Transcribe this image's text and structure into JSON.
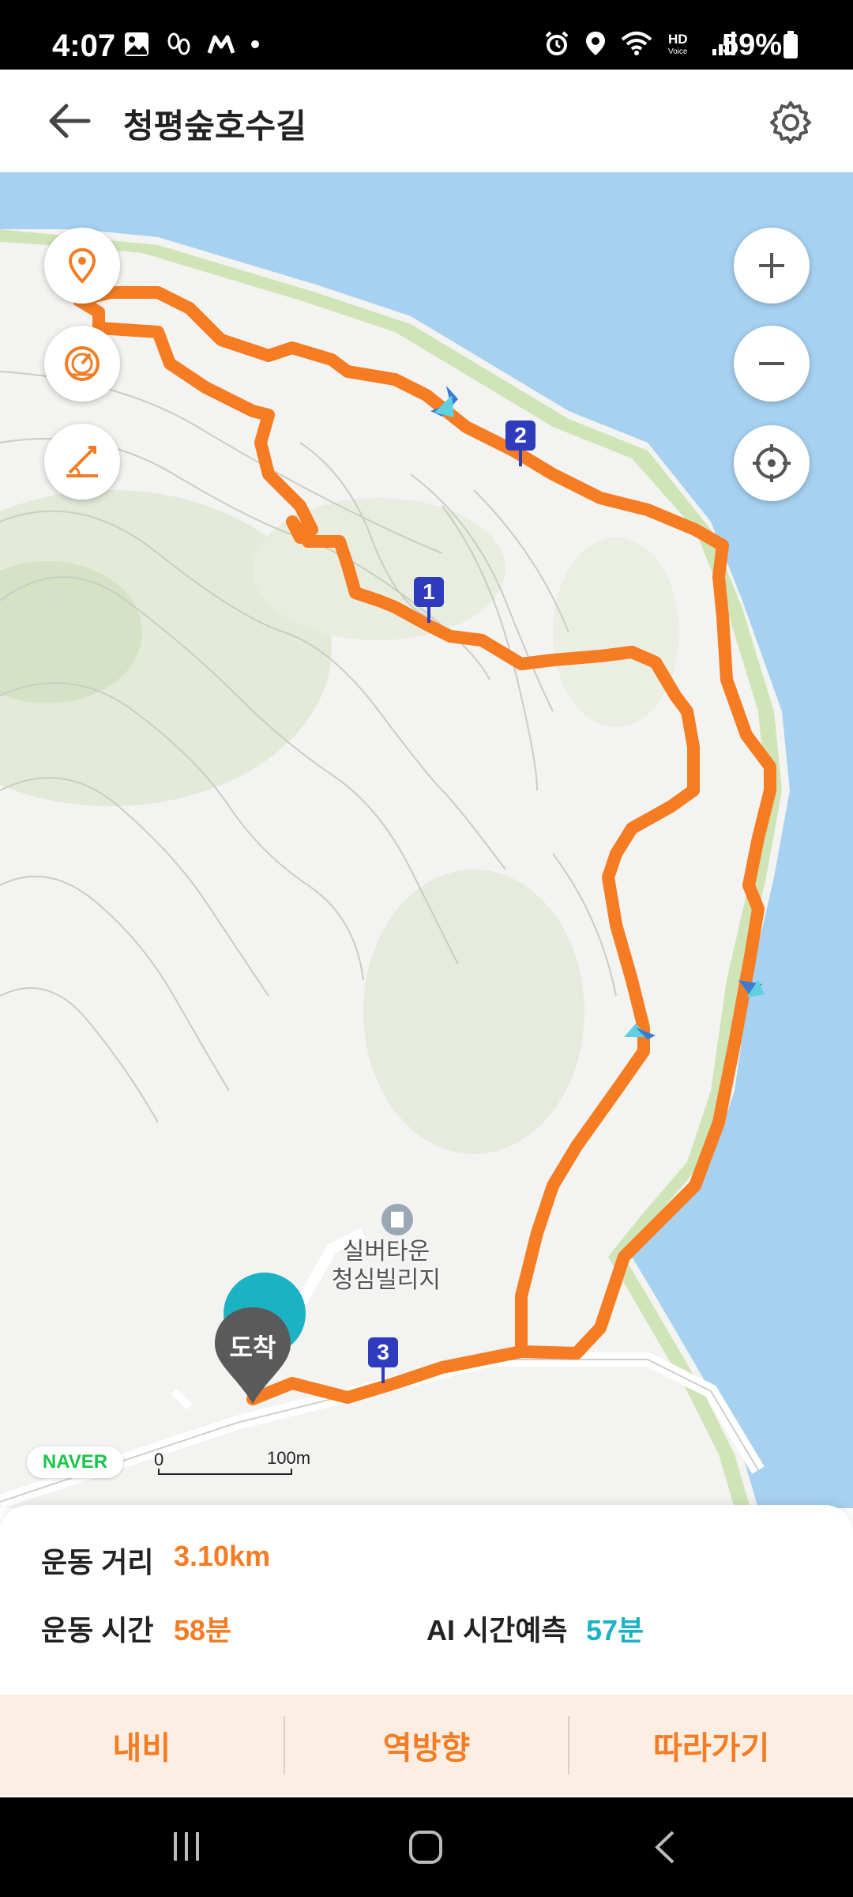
{
  "status_bar": {
    "time": "4:07",
    "battery": "59%",
    "left_icons": [
      "gallery-icon",
      "footprints-icon",
      "app-icon",
      "dot-icon"
    ],
    "right_icons": [
      "alarm-icon",
      "location-icon",
      "wifi-icon",
      "hd-voice-icon",
      "signal-icon",
      "battery-icon"
    ]
  },
  "header": {
    "title": "청평숲호수길"
  },
  "map": {
    "markers": [
      "1",
      "2",
      "3"
    ],
    "poi": {
      "line1": "실버타운",
      "line2": "청심빌리지"
    },
    "arrive_label": "도착",
    "logo": "NAVER",
    "scale": {
      "start": "0",
      "end": "100m"
    },
    "colors": {
      "route": "#f57c22",
      "water": "#a6d1f0",
      "marker": "#2f3bbd"
    }
  },
  "stats": {
    "distance_label": "운동 거리",
    "distance_value": "3.10km",
    "time_label": "운동 시간",
    "time_value": "58분",
    "ai_label": "AI 시간예측",
    "ai_value": "57분"
  },
  "actions": {
    "nav": "내비",
    "reverse": "역방향",
    "follow": "따라가기"
  }
}
